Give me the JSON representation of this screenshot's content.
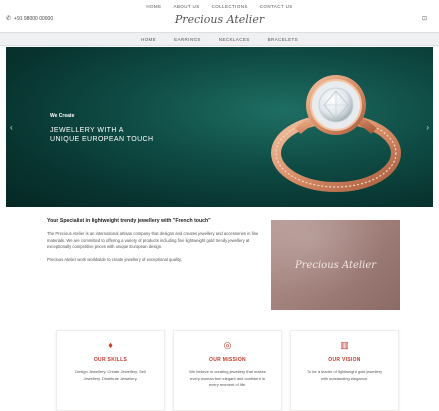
{
  "topnav": {
    "items": [
      "Home",
      "About Us",
      "Collections",
      "Contact Us"
    ]
  },
  "header": {
    "phone": "+91 98000 00000",
    "logo": "Precious Atelier",
    "phone_icon": "phone-icon",
    "cart_icon": "cart-icon"
  },
  "subnav": {
    "items": [
      "Home",
      "Earrings",
      "Necklaces",
      "Bracelets"
    ]
  },
  "hero": {
    "kicker": "We Create",
    "title_line1": "Jewellery with a",
    "title_line2": "Unique European Touch",
    "prev": "‹",
    "next": "›",
    "bg_color": "#0f4c45"
  },
  "about": {
    "heading": "Your Specialist in lightweight trendy jewellery with \"French touch\"",
    "para1": "The Precious Atelier is an international artisan company that designs and creates jewellery and accessories in fine materials. We are committed to offering a variety of products including fine lightweight gold trendy jewellery at exceptionally competitive prices with unique European design.",
    "para2": "Precious Atelier work worldwide to create jewellery of exceptional quality.",
    "brand": "Precious Atelier"
  },
  "cards": [
    {
      "icon": "diamond-icon",
      "glyph": "♦",
      "title": "Our Skills",
      "text": "Design Jewellery. Create Jewellery. Sell Jewellery. Distribute Jewellery."
    },
    {
      "icon": "target-icon",
      "glyph": "◎",
      "title": "Our Mission",
      "text": "We believe in creating jewellery that makes every woman feel elegant and confident in every moment of life."
    },
    {
      "icon": "chart-icon",
      "glyph": "▥",
      "title": "Our Vision",
      "text": "To be a leader of lightweight gold jewellery with outstanding elegance."
    }
  ],
  "colors": {
    "accent": "#c0392b",
    "hero": "#0f4c45",
    "brandbox": "#a2807b"
  }
}
